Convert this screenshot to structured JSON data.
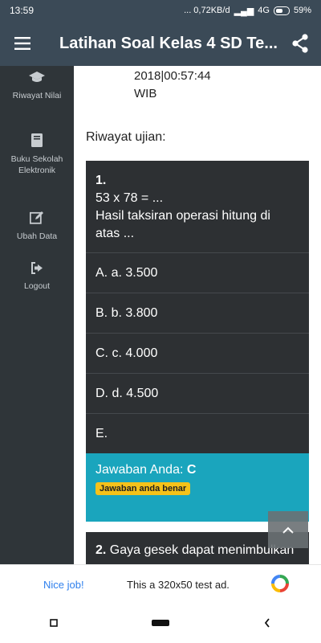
{
  "status": {
    "time": "13:59",
    "network": "... 0,72KB/d",
    "signal": "4G",
    "battery": "59%"
  },
  "appbar": {
    "title": "Latihan Soal Kelas 4 SD Te..."
  },
  "sidebar": {
    "items": [
      {
        "label": "Riwayat Nilai",
        "icon": "graduation-cap-icon"
      },
      {
        "label": "Buku Sekolah Elektronik",
        "icon": "book-icon"
      },
      {
        "label": "Ubah Data",
        "icon": "edit-icon"
      },
      {
        "label": "Logout",
        "icon": "logout-icon"
      }
    ]
  },
  "main": {
    "datetime_line1": "2018|00:57:44",
    "datetime_line2": "WIB",
    "history_label": "Riwayat ujian:",
    "question1": {
      "number": "1.",
      "line1": "53 x 78 = ...",
      "line2": "Hasil taksiran operasi hitung di",
      "line3": "atas ...",
      "options": [
        "A. a. 3.500",
        "B. b. 3.800",
        "C. c. 4.000",
        "D. d. 4.500",
        "E."
      ],
      "answer_prefix": "Jawaban Anda: ",
      "answer_value": "C",
      "result_badge": "Jawaban anda benar"
    },
    "question2": {
      "number": "2.",
      "text": "Gaya gesek dapat menimbulkan"
    }
  },
  "ad": {
    "nice": "Nice job!",
    "text": "This a 320x50 test ad."
  },
  "colors": {
    "appbar": "#3b4a57",
    "sidebar": "#2f3539",
    "card": "#2d3033",
    "answer": "#1aa5bd",
    "badge": "#f5c21a"
  }
}
